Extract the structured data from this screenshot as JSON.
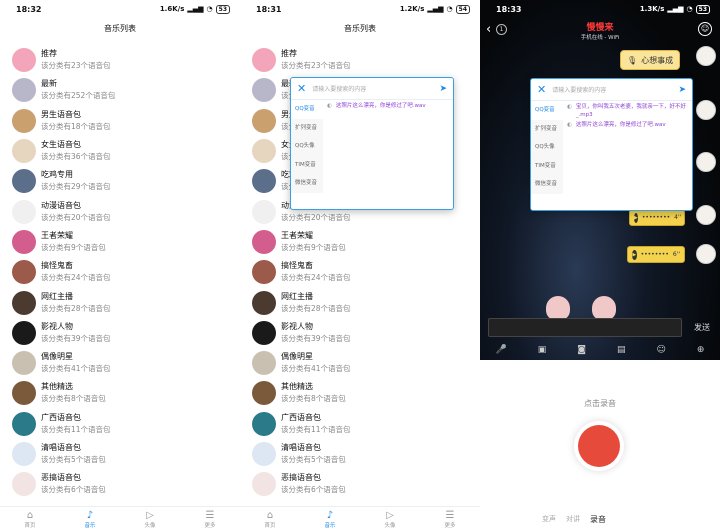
{
  "screens": [
    {
      "status": {
        "time": "18:32",
        "speed": "1.6K/s",
        "battery": "53"
      },
      "title": "音乐列表",
      "popup": null
    },
    {
      "status": {
        "time": "18:31",
        "speed": "1.2K/s",
        "battery": "54"
      },
      "title": "音乐列表"
    }
  ],
  "list": [
    {
      "title": "推荐",
      "sub": "该分类有23个语音包",
      "color": "#f3a5b9"
    },
    {
      "title": "最新",
      "sub": "该分类有252个语音包",
      "color": "#b7b7c9"
    },
    {
      "title": "男生语音包",
      "sub": "该分类有18个语音包",
      "color": "#c9a06e"
    },
    {
      "title": "女生语音包",
      "sub": "该分类有36个语音包",
      "color": "#e6d6c0"
    },
    {
      "title": "吃鸡专用",
      "sub": "该分类有29个语音包",
      "color": "#5b6f8a"
    },
    {
      "title": "动漫语音包",
      "sub": "该分类有20个语音包",
      "color": "#f0f0f0"
    },
    {
      "title": "王者荣耀",
      "sub": "该分类有9个语音包",
      "color": "#d35d8d"
    },
    {
      "title": "搞怪鬼畜",
      "sub": "该分类有24个语音包",
      "color": "#9b5a4a"
    },
    {
      "title": "网红主播",
      "sub": "该分类有28个语音包",
      "color": "#4a3a30"
    },
    {
      "title": "影视人物",
      "sub": "该分类有39个语音包",
      "color": "#1a1a1a"
    },
    {
      "title": "偶像明星",
      "sub": "该分类有41个语音包",
      "color": "#c9c0b2"
    },
    {
      "title": "其他精选",
      "sub": "该分类有8个语音包",
      "color": "#7a5a3a"
    },
    {
      "title": "广西语音包",
      "sub": "该分类有11个语音包",
      "color": "#2a7a8a"
    },
    {
      "title": "清唱语音包",
      "sub": "该分类有5个语音包",
      "color": "#dde6f3"
    },
    {
      "title": "恶搞语音包",
      "sub": "该分类有6个语音包",
      "color": "#f3e4e4"
    }
  ],
  "tabs": [
    {
      "label": "首页",
      "icon": "home-icon",
      "glyph": "⌂"
    },
    {
      "label": "音乐",
      "icon": "music-icon",
      "glyph": "♪"
    },
    {
      "label": "头像",
      "icon": "play-icon",
      "glyph": "▷"
    },
    {
      "label": "更多",
      "icon": "more-icon",
      "glyph": "☰"
    }
  ],
  "popup": {
    "placeholder": "请输入要搜索的内容",
    "categories": [
      "QQ变音",
      "扩列变音",
      "QQ头像",
      "TIM变音",
      "微信变音"
    ],
    "s2_items": [
      "这照片这么漂亮，你是修过了吧.wav"
    ],
    "s3_items": [
      "宝贝，你叫我五次老婆，我就亲一下，好不好_.mp3",
      "这照片这么漂亮，你是修过了吧.wav"
    ]
  },
  "chat": {
    "status": {
      "time": "18:33",
      "speed": "1.3K/s",
      "battery": "53"
    },
    "count": "1",
    "name": "慢慢来",
    "state": "手机在线 - WiFi",
    "wish": "心想事成",
    "voice1_secs": "4''",
    "voice2_secs": "6''",
    "send": "发送",
    "record_hint": "点击录音",
    "modes": [
      "变声",
      "对讲",
      "录音"
    ]
  }
}
